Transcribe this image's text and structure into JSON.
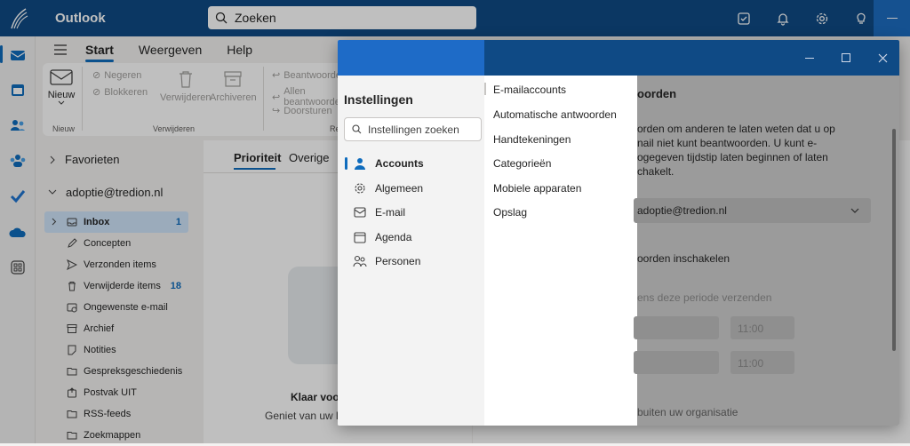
{
  "app": {
    "name": "Outlook"
  },
  "search": {
    "placeholder": "Zoeken"
  },
  "ribbon_tabs": [
    "Start",
    "Weergeven",
    "Help"
  ],
  "ribbon": {
    "new_label": "Nieuw",
    "new_group": "Nieuw",
    "ignore": "Negeren",
    "block": "Blokkeren",
    "delete": "Verwijderen",
    "archive": "Archiveren",
    "delete_group": "Verwijderen",
    "reply": "Beantwoorden",
    "reply_all": "Allen beantwoorden",
    "forward": "Doorsturen",
    "respond_group_partial": "Re"
  },
  "folders": {
    "favorites": "Favorieten",
    "account": "adoptie@tredion.nl",
    "items": [
      {
        "label": "Inbox",
        "count": "1",
        "icon": "inbox-icon"
      },
      {
        "label": "Concepten",
        "count": "",
        "icon": "pencil-icon"
      },
      {
        "label": "Verzonden items",
        "count": "",
        "icon": "send-icon"
      },
      {
        "label": "Verwijderde items",
        "count": "18",
        "icon": "trash-icon"
      },
      {
        "label": "Ongewenste e-mail",
        "count": "",
        "icon": "junk-icon"
      },
      {
        "label": "Archief",
        "count": "",
        "icon": "archive-icon"
      },
      {
        "label": "Notities",
        "count": "",
        "icon": "note-icon"
      },
      {
        "label": "Gespreksgeschiedenis",
        "count": "",
        "icon": "folder-icon"
      },
      {
        "label": "Postvak UIT",
        "count": "",
        "icon": "outbox-icon"
      },
      {
        "label": "RSS-feeds",
        "count": "",
        "icon": "folder-icon"
      },
      {
        "label": "Zoekmappen",
        "count": "",
        "icon": "folder-icon"
      }
    ]
  },
  "maillist": {
    "tab_focused": "Prioriteit",
    "tab_other": "Overige",
    "empty_title": "Klaar voo",
    "empty_sub": "Geniet van uw l"
  },
  "settings": {
    "title": "Instellingen",
    "search_placeholder": "Instellingen zoeken",
    "nav": [
      "Accounts",
      "Algemeen",
      "E-mail",
      "Agenda",
      "Personen"
    ],
    "subnav": [
      "E-mailaccounts",
      "Automatische antwoorden",
      "Handtekeningen",
      "Categorieën",
      "Mobiele apparaten",
      "Opslag"
    ],
    "right": {
      "heading": "oorden",
      "desc_1": "orden om anderen te laten weten dat u op",
      "desc_2": "nail niet kunt beantwoorden. U kunt e-",
      "desc_3": "ogegeven tijdstip laten beginnen of laten",
      "desc_4": "chakelt.",
      "account": "adoptie@tredion.nl",
      "toggle_label": "oorden inschakelen",
      "period_label": "ens deze periode verzenden",
      "time_1": "11:00",
      "time_2": "11:00",
      "external": "buiten uw organisatie"
    }
  },
  "colors": {
    "brand": "#0f4a85",
    "accent": "#0f6cbd"
  }
}
